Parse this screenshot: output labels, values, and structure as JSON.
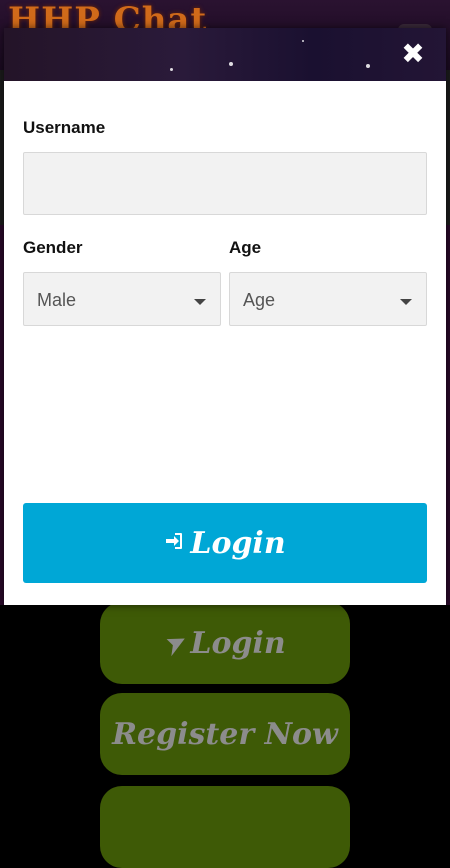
{
  "background": {
    "logo_text": "HHP Chat",
    "buttons": {
      "login_label": "Login",
      "register_label": "Register Now",
      "third_label": ""
    }
  },
  "modal": {
    "close_icon": "close-icon",
    "username": {
      "label": "Username",
      "value": "",
      "placeholder": ""
    },
    "gender": {
      "label": "Gender",
      "selected": "Male"
    },
    "age": {
      "label": "Age",
      "selected": "Age"
    },
    "submit": {
      "label": "Login",
      "icon": "sign-in-icon",
      "color": "#00a7d6"
    }
  }
}
